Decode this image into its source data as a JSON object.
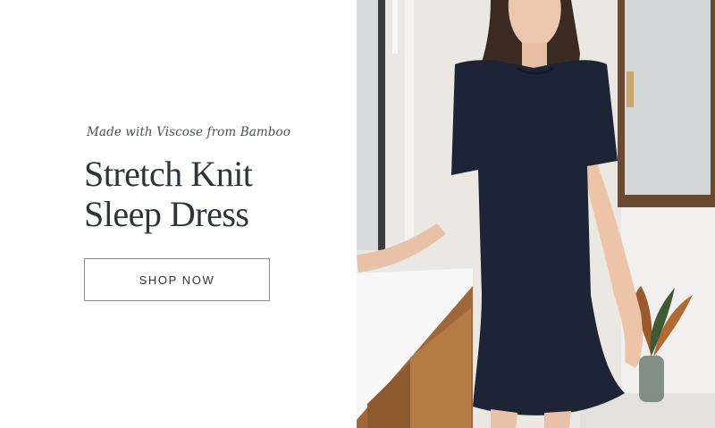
{
  "hero": {
    "subtitle": "Made with Viscose from Bamboo",
    "headline_line1": "Stretch Knit",
    "headline_line2": "Sleep Dress",
    "cta_label": "SHOP NOW"
  },
  "photo": {
    "dress_color": "#1d2436",
    "description_icon": "model-photo"
  },
  "colors": {
    "headline": "#2f3439",
    "button_border": "#8a8e92"
  }
}
